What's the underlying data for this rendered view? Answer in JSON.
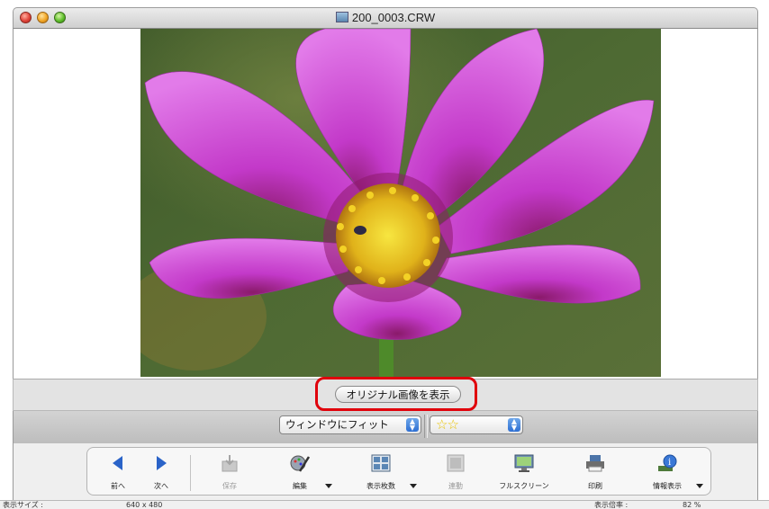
{
  "window": {
    "title": "200_0003.CRW"
  },
  "view": {
    "show_original_button": "オリジナル画像を表示"
  },
  "controls": {
    "fit_select": "ウィンドウにフィット",
    "rating_select": "☆☆"
  },
  "toolbar": {
    "prev": "前へ",
    "next": "次へ",
    "save": "保存",
    "edit": "編集",
    "display_count": "表示枚数",
    "linked": "連動",
    "fullscreen": "フルスクリーン",
    "print": "印刷",
    "info": "情報表示"
  },
  "status": {
    "size_label": "表示サイズ :",
    "size_value": "640 x 480",
    "zoom_label": "表示倍率 :",
    "zoom_value": "82 %"
  },
  "colors": {
    "highlight": "#e0000b",
    "flower": "#c84fd6",
    "accent": "#2d6fd3"
  }
}
